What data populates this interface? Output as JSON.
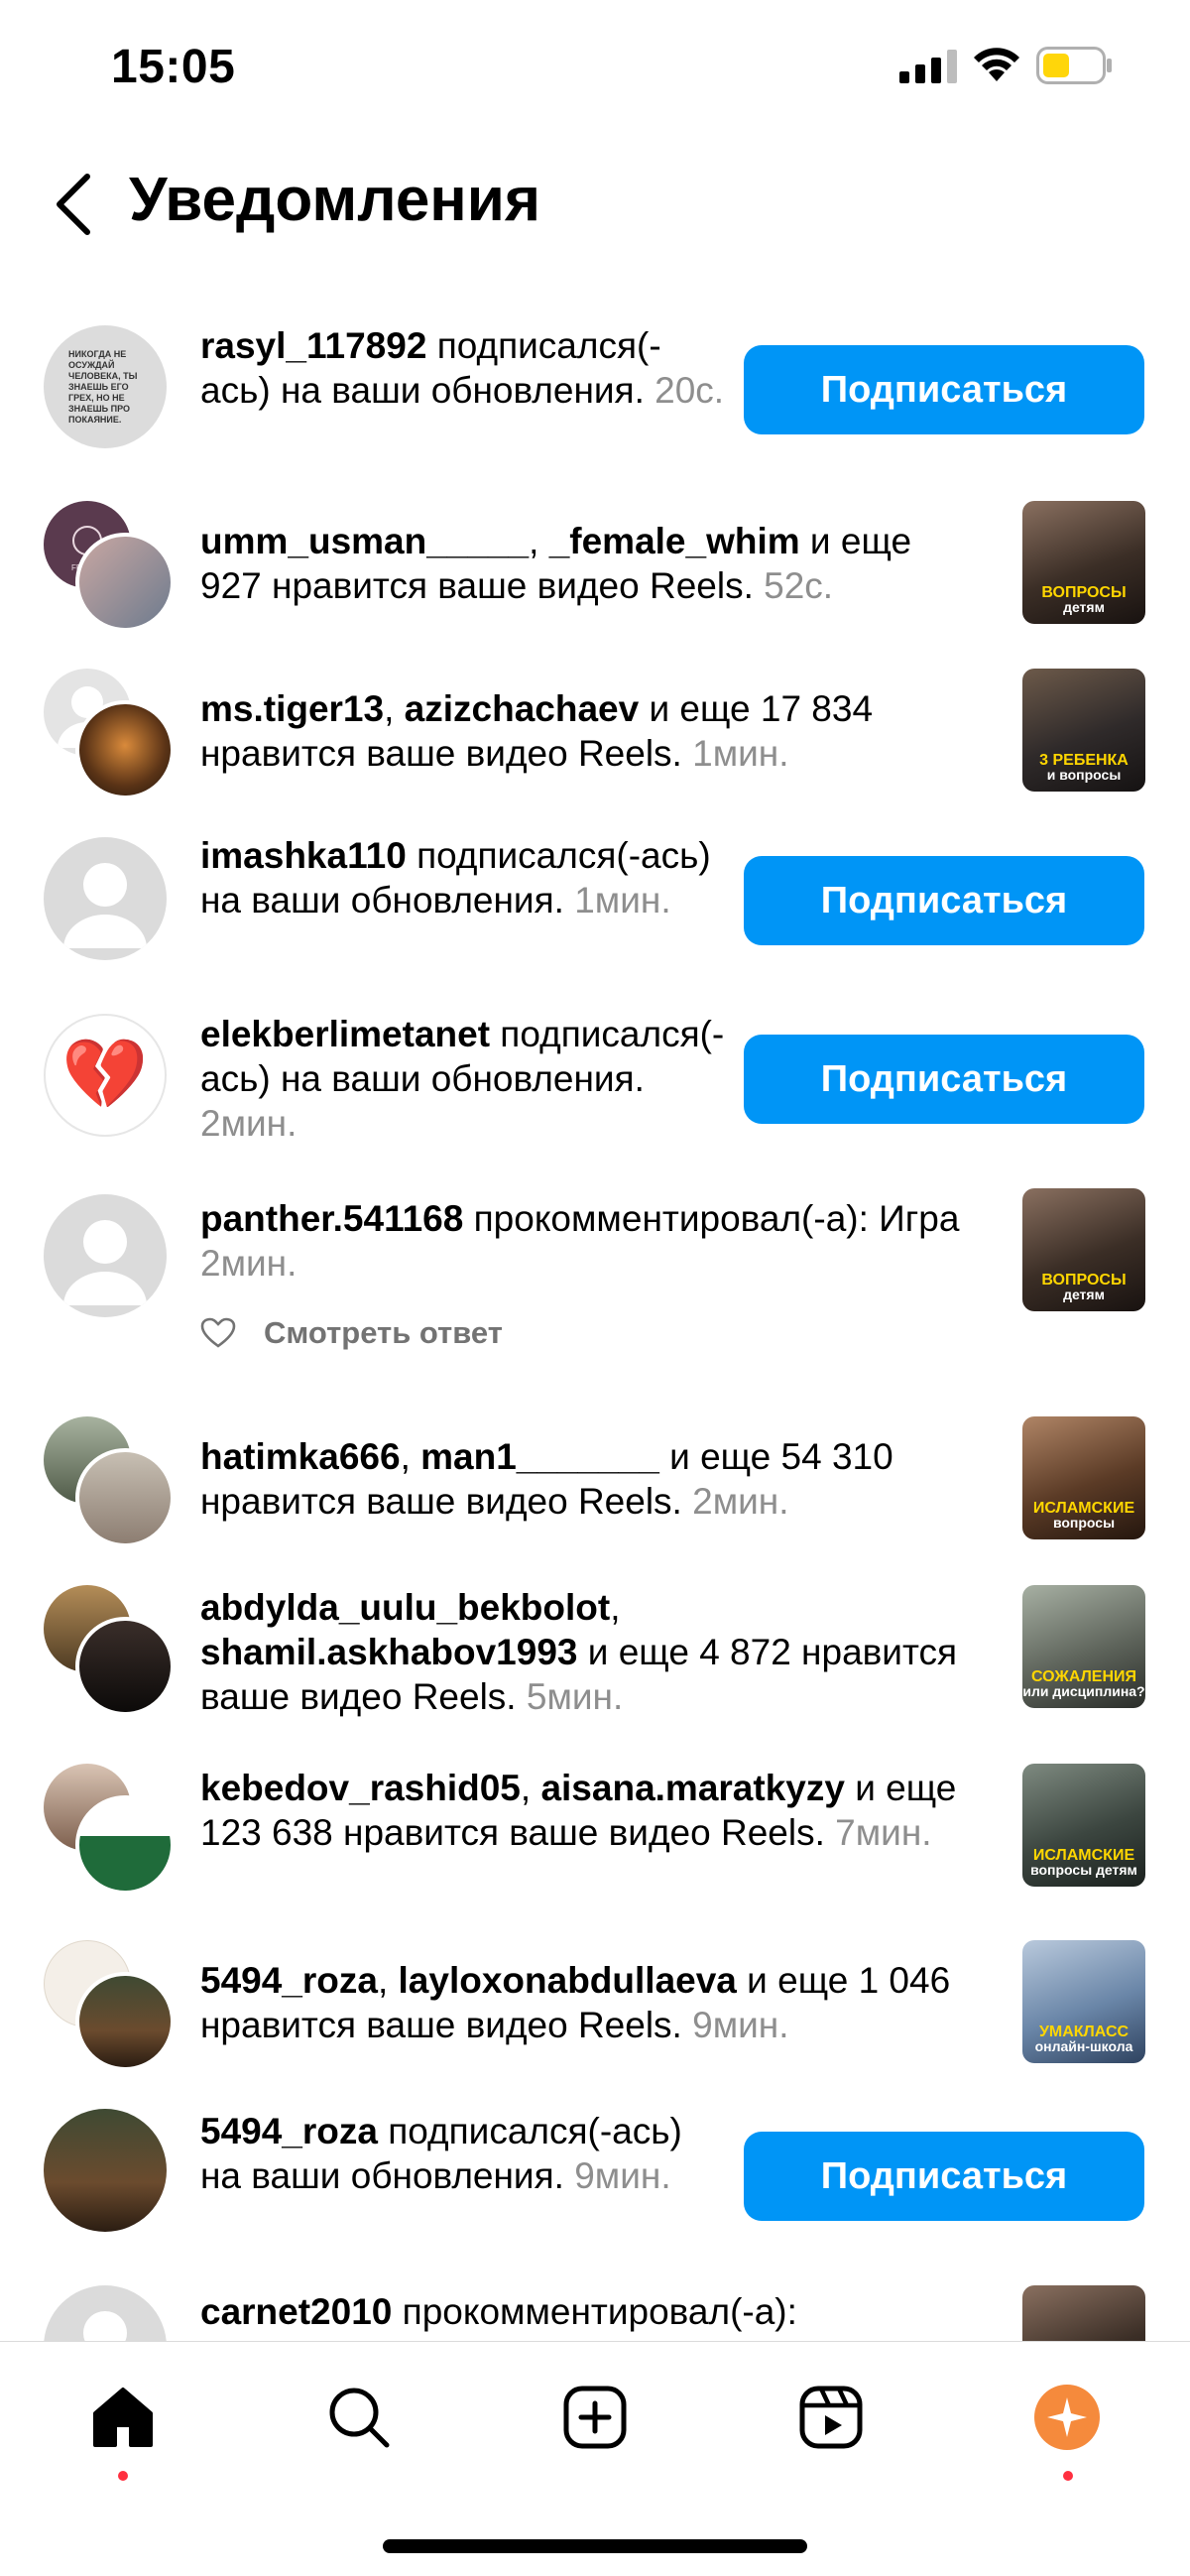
{
  "status_bar": {
    "time": "15:05"
  },
  "header": {
    "title": "Уведомления"
  },
  "follow_label": "Подписаться",
  "notifications": [
    {
      "user1": "rasyl_117892",
      "rest": " подписался(-ась) на ваши обновления. ",
      "time": "20с.",
      "avatar_text": "НИКОГДА НЕ ОСУЖДАЙ ЧЕЛОВЕКА, ТЫ ЗНАЕШЬ ЕГО ГРЕХ, НО НЕ ЗНАЕШЬ ПРО ПОКАЯНИЕ."
    },
    {
      "user1": "umm_usman_____",
      "sep": ", ",
      "user2": "_female_whim",
      "rest": " и еще 927 нравится ваше видео Reels. ",
      "time": "52с.",
      "thumb_caption": "ВОПРОСЫ",
      "thumb_sub": "детям"
    },
    {
      "user1": "ms.tiger13",
      "sep": ", ",
      "user2": "azizchachaev",
      "rest": " и еще 17 834 нравится ваше видео Reels. ",
      "time": "1мин.",
      "thumb_caption": "3 РЕБЕНКА",
      "thumb_sub": "и вопросы"
    },
    {
      "user1": "imashka110",
      "rest": " подписался(-ась) на ваши обновления. ",
      "time": "1мин."
    },
    {
      "user1": "elekberlimetanet",
      "rest": " подписался(-ась) на ваши обновления. ",
      "time": "2мин.",
      "avatar_emoji": "💔"
    },
    {
      "user1": "panther.541168",
      "rest": " прокомментировал(-а): Игра ",
      "time": "2мин.",
      "reply_label": "Смотреть ответ",
      "thumb_caption": "ВОПРОСЫ",
      "thumb_sub": "детям"
    },
    {
      "user1": "hatimka666",
      "sep": ", ",
      "user2": "man1_______",
      "rest": " и еще 54 310 нравится ваше видео Reels. ",
      "time": "2мин.",
      "thumb_caption": "ИСЛАМСКИЕ",
      "thumb_sub": "вопросы"
    },
    {
      "user1": "abdylda_uulu_bekbolot",
      "sep": ", ",
      "user2": "shamil.askhabov1993",
      "rest": " и еще 4 872 нравится ваше видео Reels. ",
      "time": "5мин.",
      "thumb_caption": "СОЖАЛЕНИЯ",
      "thumb_sub": "или дисциплина?"
    },
    {
      "user1": "kebedov_rashid05",
      "sep": ", ",
      "user2": "aisana.maratkyzy",
      "rest": " и еще 123 638 нравится ваше видео Reels. ",
      "time": "7мин.",
      "thumb_caption": "ИСЛАМСКИЕ",
      "thumb_sub": "вопросы детям"
    },
    {
      "user1": "5494_roza",
      "sep": ", ",
      "user2": "layloxonabdullaeva",
      "rest": " и еще 1 046 нравится ваше видео Reels. ",
      "time": "9мин.",
      "thumb_caption": "УМАКЛАСС",
      "thumb_sub": "онлайн-школа"
    },
    {
      "user1": "5494_roza",
      "rest": " подписался(-ась) на ваши обновления. ",
      "time": "9мин."
    },
    {
      "user1": "carnet2010",
      "rest": " прокомментировал(-а):",
      "time": ""
    }
  ],
  "tab_bar": [
    "home-icon",
    "search-icon",
    "create-icon",
    "reels-icon",
    "profile-icon"
  ]
}
